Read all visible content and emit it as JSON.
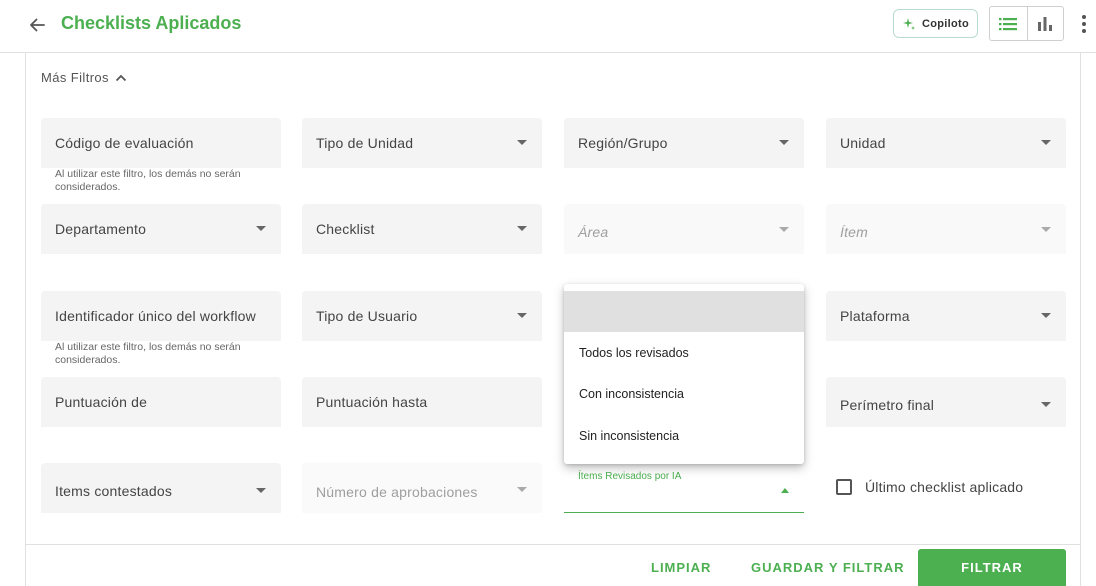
{
  "header": {
    "title": "Checklists Aplicados",
    "copilot_label": "Copiloto",
    "colors": {
      "accent": "#4caf50",
      "copilot_border": "#b9dccf"
    }
  },
  "filters": {
    "more_filters_label": "Más Filtros",
    "helper_text": "Al utilizar este filtro, los demás no serán considerados.",
    "row1": [
      "Código de evaluación",
      "Tipo de Unidad",
      "Región/Grupo",
      "Unidad"
    ],
    "row2": [
      "Departamento",
      "Checklist",
      "Área",
      "Ítem"
    ],
    "row3": [
      "Identificador único del workflow",
      "Tipo de Usuario",
      "Plataforma"
    ],
    "row4": [
      "Puntuación de",
      "Puntuación hasta",
      "Perímetro final"
    ],
    "row5": [
      "Items contestados",
      "Número de aprobaciones",
      "Ítems Revisados por IA"
    ],
    "last_checklist_label": "Último checklist aplicado"
  },
  "dropdown": {
    "options": [
      "",
      "Todos los revisados",
      "Con inconsistencia",
      "Sin inconsistencia"
    ]
  },
  "actions": {
    "clear": "LIMPIAR",
    "save_filter": "GUARDAR Y FILTRAR",
    "filter": "FILTRAR"
  },
  "icons": [
    "arrow-left-icon",
    "sparkle-icon",
    "list-view-icon",
    "bar-chart-icon",
    "more-vertical-icon",
    "chevron-up-icon",
    "caret-down-icon"
  ]
}
